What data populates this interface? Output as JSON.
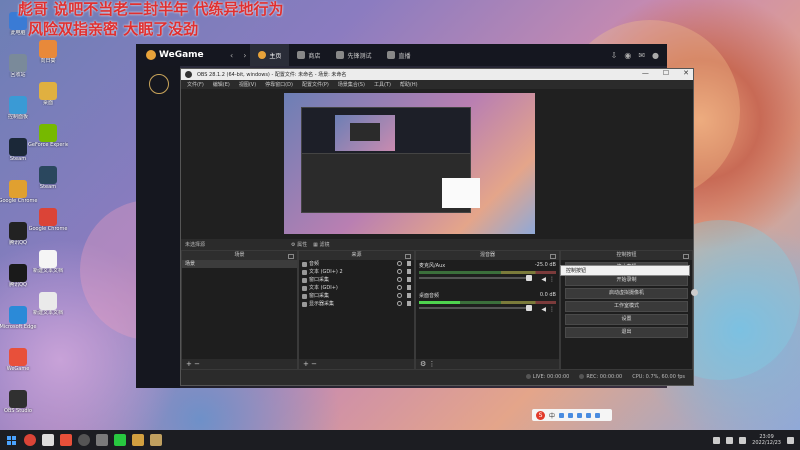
{
  "overlay_text": {
    "line1": "彪哥  说吧不当老二封半年   代练异地行为",
    "line2": "风险双指亲密  大眠了没劲"
  },
  "desktop_icons": [
    {
      "label": "此电脑",
      "icon": "computer-icon",
      "color": "#3a7bd5"
    },
    {
      "label": "回收站",
      "icon": "recycle-bin-icon",
      "color": "#7a8a9a"
    },
    {
      "label": "控制面板",
      "icon": "control-panel-icon",
      "color": "#3a9ad5"
    },
    {
      "label": "Steam",
      "icon": "steam-icon",
      "color": "#1b2838"
    },
    {
      "label": "Google Chrome",
      "icon": "chrome-icon",
      "color": "#e0a030"
    },
    {
      "label": "腾讯QQ",
      "icon": "qq-icon",
      "color": "#222222"
    },
    {
      "label": "腾讯QQ",
      "icon": "penguin-icon",
      "color": "#1a1a1a"
    },
    {
      "label": "Microsoft Edge",
      "icon": "edge-icon",
      "color": "#2b8ad8"
    },
    {
      "label": "WeGame",
      "icon": "wegame-icon",
      "color": "#e8503a"
    },
    {
      "label": "OBS Studio",
      "icon": "obs-icon",
      "color": "#303030"
    }
  ],
  "desktop_icons_col2": [
    {
      "label": "向日葵",
      "icon": "app-icon",
      "color": "#e8893a"
    },
    {
      "label": "桌面",
      "icon": "folder-icon",
      "color": "#e0b040"
    },
    {
      "label": "GeForce Experience",
      "icon": "nvidia-icon",
      "color": "#76b900"
    },
    {
      "label": "Steam",
      "icon": "steam-icon",
      "color": "#2a475e"
    },
    {
      "label": "Google Chrome",
      "icon": "chrome-icon",
      "color": "#db4437"
    },
    {
      "label": "新建文本文档",
      "icon": "document-icon",
      "color": "#f5f5f5"
    },
    {
      "label": "新建文本文档",
      "icon": "document-icon",
      "color": "#eaeaea"
    }
  ],
  "wegame": {
    "logo": "WeGame",
    "tabs": [
      {
        "label": "主页",
        "active": true
      },
      {
        "label": "商店",
        "active": false
      },
      {
        "label": "先锋测试",
        "active": false
      },
      {
        "label": "直播",
        "active": false
      }
    ]
  },
  "obs": {
    "title": "OBS 28.1.2 (64-bit, windows) - 配置文件: 未命名 - 场景: 未命名",
    "window_controls": [
      "—",
      "☐",
      "✕"
    ],
    "menu": [
      "文件(F)",
      "编辑(E)",
      "视图(V)",
      "停靠窗口(D)",
      "配置文件(P)",
      "场景集合(S)",
      "工具(T)",
      "帮助(H)"
    ],
    "source_bar": {
      "label": "未选择源",
      "properties": "属性",
      "filters": "滤镜"
    },
    "docks": {
      "scenes": {
        "title": "场景",
        "items": [
          "场景"
        ]
      },
      "sources": {
        "title": "来源",
        "items": [
          "音频",
          "文本 (GDI+) 2",
          "窗口采集",
          "文本 (GDI+)",
          "窗口采集",
          "显示器采集"
        ]
      },
      "mixer": {
        "title": "混音器",
        "channels": [
          {
            "name": "麦克风/Aux",
            "db": "-25.0 dB",
            "active": false
          },
          {
            "name": "桌面音频",
            "db": "0.0 dB",
            "active": true
          }
        ]
      },
      "controls": {
        "title": "控制按钮",
        "buttons": [
          "停止直播",
          "开始录制",
          "启动虚拟摄像机",
          "工作室模式",
          "设置",
          "退出"
        ]
      }
    },
    "footer_add": "+ −",
    "status": {
      "live": "LIVE: 00:00:00",
      "rec": "REC: 00:00:00",
      "cpu": "CPU: 0.7%, 60.00 fps"
    },
    "tooltip": "控制按钮"
  },
  "taskbar": {
    "clock_time": "23:09",
    "clock_date": "2022/12/23",
    "ime_label": "中"
  },
  "colors": {
    "accent_live": "#4fd34f",
    "wegame_brand": "#e8a33a",
    "overlay_red": "#e03030"
  }
}
